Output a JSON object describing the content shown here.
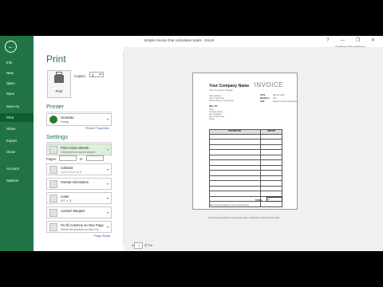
{
  "window": {
    "title": "Simple invoice that calculates total1 - Excel",
    "user": "Siddhant Muralidhara",
    "controls": [
      "?",
      "—",
      "❐",
      "✕"
    ]
  },
  "sidebar": {
    "back_glyph": "←",
    "items": [
      {
        "label": "Info"
      },
      {
        "label": "New"
      },
      {
        "label": "Open"
      },
      {
        "label": "Save"
      },
      {
        "label": "Save As"
      },
      {
        "label": "Print"
      },
      {
        "label": "Share"
      },
      {
        "label": "Export"
      },
      {
        "label": "Close"
      },
      {
        "label": "Account"
      },
      {
        "label": "Options"
      }
    ],
    "active": "Print"
  },
  "print_panel": {
    "heading": "Print",
    "print_button": "Print",
    "copies_label": "Copies:",
    "copies_value": "1",
    "printer_heading": "Printer",
    "printer_name": "OneNote",
    "printer_status": "Ready",
    "printer_properties": "Printer Properties",
    "settings_heading": "Settings",
    "settings": [
      {
        "title": "Print Active Sheets",
        "subtitle": "Only print the active sheets"
      },
      {
        "title": "Collated",
        "subtitle": "1,2,3   1,2,3   1,2,3"
      },
      {
        "title": "Portrait Orientation",
        "subtitle": ""
      },
      {
        "title": "Letter",
        "subtitle": "8.5\" x 11\""
      },
      {
        "title": "Custom Margins",
        "subtitle": ""
      },
      {
        "title": "Fit All Columns on One Page",
        "subtitle": "Shrink the printout so that it is..."
      }
    ],
    "pages_label": "Pages:",
    "to_label": "to",
    "page_setup": "Page Setup"
  },
  "preview": {
    "company": "Your Company Name",
    "slogan": "Your Company Slogan",
    "invoice_word": "INVOICE",
    "address_lines": [
      "Street Address",
      "City, ST ZIP Code",
      "Phone Number | Fax Number"
    ],
    "meta": [
      {
        "label": "DATE",
        "value": "May 20, 2013"
      },
      {
        "label": "INVOICE #",
        "value": "100"
      },
      {
        "label": "FOR:",
        "value": "Project or service description"
      }
    ],
    "bill_to_label": "BILL TO:",
    "bill_to_lines": [
      "Name",
      "Company Name",
      "Street Address",
      "City, ST ZIP Code",
      "Phone"
    ],
    "table_headers": [
      "DESCRIPTION",
      "AMOUNT"
    ],
    "total_label": "TOTAL",
    "total_value": "0",
    "footer_lines": [
      "Make all checks payable to Your Company Name",
      "If you have any questions concerning this invoice, contact Name, Phone Number, Email"
    ],
    "page_current": "1",
    "page_total": "of 2"
  },
  "colors": {
    "accent": "#217346",
    "accent_dark": "#0e5c2f"
  }
}
